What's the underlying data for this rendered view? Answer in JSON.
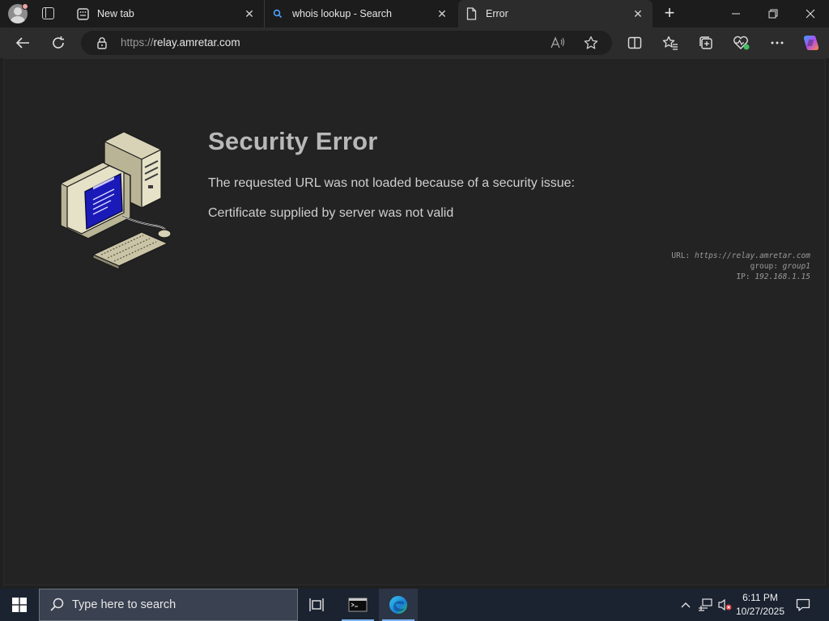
{
  "browser": {
    "tabs": [
      {
        "label": "New tab",
        "icon": "newtab-page-icon",
        "active": false
      },
      {
        "label": "whois lookup - Search",
        "icon": "search-icon",
        "active": false
      },
      {
        "label": "Error",
        "icon": "document-icon",
        "active": true
      }
    ],
    "address": {
      "scheme": "https://",
      "host": "relay.amretar.com"
    }
  },
  "page": {
    "title": "Security Error",
    "message": "The requested URL was not loaded because of a security issue:",
    "detail": "Certificate supplied by server was not valid",
    "meta": {
      "url_label": "URL:",
      "url_value": "https://relay.amretar.com",
      "group_label": "group:",
      "group_value": "group1",
      "ip_label": "IP:",
      "ip_value": "192.168.1.15"
    }
  },
  "taskbar": {
    "search_placeholder": "Type here to search",
    "time": "6:11 PM",
    "date": "10/27/2025"
  },
  "colors": {
    "page_background": "#232323",
    "title": "#b8b8b8",
    "taskbar": "#1b2230",
    "monitor_screen": "#1a1ab8"
  }
}
